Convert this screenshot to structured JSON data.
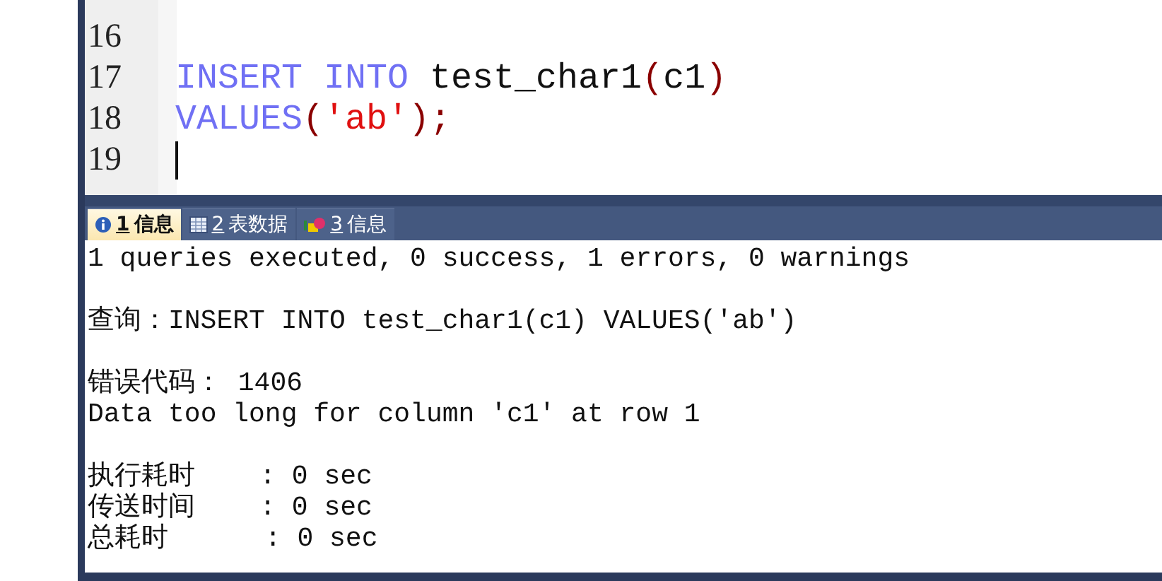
{
  "editor": {
    "lines": [
      {
        "number": "16"
      },
      {
        "number": "17",
        "tokens": [
          {
            "kind": "keyword",
            "text": "INSERT INTO"
          },
          {
            "kind": "ident",
            "text": " test_char1"
          },
          {
            "kind": "punct",
            "text": "("
          },
          {
            "kind": "ident",
            "text": "c1"
          },
          {
            "kind": "punct",
            "text": ")"
          }
        ]
      },
      {
        "number": "18",
        "tokens": [
          {
            "kind": "keyword",
            "text": "VALUES"
          },
          {
            "kind": "punct",
            "text": "("
          },
          {
            "kind": "string",
            "text": "'ab'"
          },
          {
            "kind": "punct",
            "text": ");"
          }
        ]
      },
      {
        "number": "19",
        "cursor": true
      }
    ]
  },
  "result_tabs": [
    {
      "key": "1",
      "label": "信息",
      "kind": "info",
      "selected": true
    },
    {
      "key": "2",
      "label": "表数据",
      "kind": "grid",
      "selected": false
    },
    {
      "key": "3",
      "label": "信息",
      "kind": "shapes",
      "selected": false
    }
  ],
  "messages": [
    [
      "1 queries executed, 0 success, 1 errors, 0 warnings"
    ],
    [
      "查询：INSERT INTO test_char1(c1) VALUES('ab')"
    ],
    [
      "错误代码： 1406",
      "Data too long for column 'c1' at row 1"
    ],
    [
      "执行耗时    : 0 sec",
      "传送时间    : 0 sec",
      "总耗时      : 0 sec"
    ]
  ]
}
